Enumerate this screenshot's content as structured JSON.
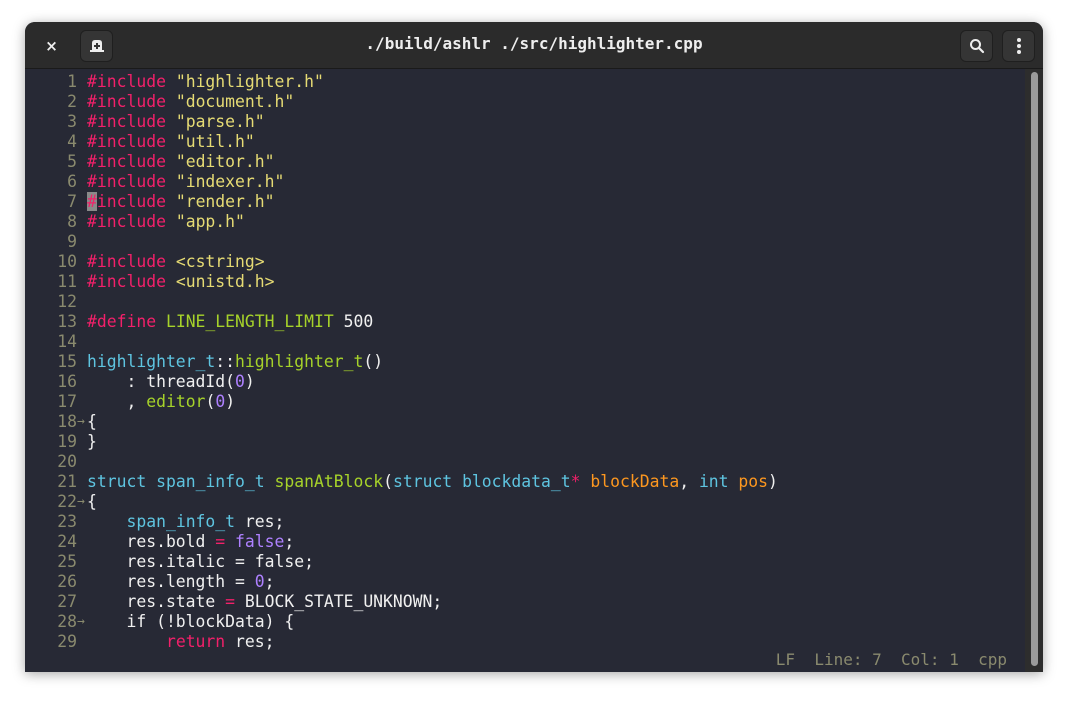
{
  "window": {
    "title": "./build/ashlr ./src/highlighter.cpp",
    "close_label": "×",
    "buttons": {
      "close": "close-icon",
      "new_tab": "new-tab-icon",
      "search": "search-icon",
      "menu": "more-vertical-icon"
    }
  },
  "editor": {
    "lines": [
      {
        "n": "1",
        "tokens": [
          [
            "kw-pre",
            "#include"
          ],
          [
            "",
            " "
          ],
          [
            "str",
            "\"highlighter.h\""
          ]
        ]
      },
      {
        "n": "2",
        "tokens": [
          [
            "kw-pre",
            "#include"
          ],
          [
            "",
            " "
          ],
          [
            "str",
            "\"document.h\""
          ]
        ]
      },
      {
        "n": "3",
        "tokens": [
          [
            "kw-pre",
            "#include"
          ],
          [
            "",
            " "
          ],
          [
            "str",
            "\"parse.h\""
          ]
        ]
      },
      {
        "n": "4",
        "tokens": [
          [
            "kw-pre",
            "#include"
          ],
          [
            "",
            " "
          ],
          [
            "str",
            "\"util.h\""
          ]
        ]
      },
      {
        "n": "5",
        "tokens": [
          [
            "kw-pre",
            "#include"
          ],
          [
            "",
            " "
          ],
          [
            "str",
            "\"editor.h\""
          ]
        ]
      },
      {
        "n": "6",
        "tokens": [
          [
            "kw-pre",
            "#include"
          ],
          [
            "",
            " "
          ],
          [
            "str",
            "\"indexer.h\""
          ]
        ]
      },
      {
        "n": "7",
        "tokens": [
          [
            "cursor",
            "#"
          ],
          [
            "kw-pre",
            "include"
          ],
          [
            "",
            " "
          ],
          [
            "str",
            "\"render.h\""
          ]
        ]
      },
      {
        "n": "8",
        "tokens": [
          [
            "kw-pre",
            "#include"
          ],
          [
            "",
            " "
          ],
          [
            "str",
            "\"app.h\""
          ]
        ]
      },
      {
        "n": "9",
        "tokens": []
      },
      {
        "n": "10",
        "tokens": [
          [
            "kw-pre",
            "#include"
          ],
          [
            "",
            " "
          ],
          [
            "str",
            "<cstring>"
          ]
        ]
      },
      {
        "n": "11",
        "tokens": [
          [
            "kw-pre",
            "#include"
          ],
          [
            "",
            " "
          ],
          [
            "str",
            "<unistd.h>"
          ]
        ]
      },
      {
        "n": "12",
        "tokens": []
      },
      {
        "n": "13",
        "tokens": [
          [
            "kw-pre",
            "#define"
          ],
          [
            "",
            " "
          ],
          [
            "fn",
            "LINE_LENGTH_LIMIT"
          ],
          [
            "",
            " 500"
          ]
        ]
      },
      {
        "n": "14",
        "tokens": []
      },
      {
        "n": "15",
        "tokens": [
          [
            "type",
            "highlighter_t"
          ],
          [
            "",
            "::"
          ],
          [
            "fn",
            "highlighter_t"
          ],
          [
            "",
            "()"
          ]
        ]
      },
      {
        "n": "16",
        "tokens": [
          [
            "",
            "    : threadId("
          ],
          [
            "num",
            "0"
          ],
          [
            "",
            ")"
          ]
        ]
      },
      {
        "n": "17",
        "tokens": [
          [
            "",
            "    , "
          ],
          [
            "fn",
            "editor"
          ],
          [
            "",
            "("
          ],
          [
            "num",
            "0"
          ],
          [
            "",
            ")"
          ]
        ]
      },
      {
        "n": "18",
        "fold": true,
        "tokens": [
          [
            "",
            "{"
          ]
        ]
      },
      {
        "n": "19",
        "tokens": [
          [
            "",
            "}"
          ]
        ]
      },
      {
        "n": "20",
        "tokens": []
      },
      {
        "n": "21",
        "tokens": [
          [
            "type",
            "struct"
          ],
          [
            "",
            " "
          ],
          [
            "type",
            "span_info_t"
          ],
          [
            "",
            " "
          ],
          [
            "fn",
            "spanAtBlock"
          ],
          [
            "",
            "("
          ],
          [
            "type",
            "struct"
          ],
          [
            "",
            " "
          ],
          [
            "type",
            "blockdata_t"
          ],
          [
            "op",
            "*"
          ],
          [
            "",
            " "
          ],
          [
            "param",
            "blockData"
          ],
          [
            "",
            ", "
          ],
          [
            "type",
            "int"
          ],
          [
            "",
            " "
          ],
          [
            "param",
            "pos"
          ],
          [
            "",
            ")"
          ]
        ]
      },
      {
        "n": "22",
        "fold": true,
        "tokens": [
          [
            "",
            "{"
          ]
        ]
      },
      {
        "n": "23",
        "tokens": [
          [
            "",
            "    "
          ],
          [
            "type",
            "span_info_t"
          ],
          [
            "",
            " res;"
          ]
        ]
      },
      {
        "n": "24",
        "tokens": [
          [
            "",
            "    res.bold "
          ],
          [
            "op",
            "="
          ],
          [
            "",
            " "
          ],
          [
            "num",
            "false"
          ],
          [
            "",
            ";"
          ]
        ]
      },
      {
        "n": "25",
        "tokens": [
          [
            "",
            "    res.italic = false;"
          ]
        ]
      },
      {
        "n": "26",
        "tokens": [
          [
            "",
            "    res.length = "
          ],
          [
            "num",
            "0"
          ],
          [
            "",
            ";"
          ]
        ]
      },
      {
        "n": "27",
        "tokens": [
          [
            "",
            "    res.state "
          ],
          [
            "op",
            "="
          ],
          [
            "",
            " BLOCK_STATE_UNKNOWN;"
          ]
        ]
      },
      {
        "n": "28",
        "fold": true,
        "tokens": [
          [
            "",
            "    if (!blockData) {"
          ]
        ]
      },
      {
        "n": "29",
        "tokens": [
          [
            "",
            "        "
          ],
          [
            "kw-pre",
            "return"
          ],
          [
            "",
            " res;"
          ]
        ]
      }
    ],
    "fold_arrow": "→"
  },
  "statusbar": {
    "eol": "LF",
    "line_label": "Line: 7",
    "col_label": "Col: 1",
    "language": "cpp"
  },
  "scrollbar": {
    "visible_fraction": 1.0
  }
}
